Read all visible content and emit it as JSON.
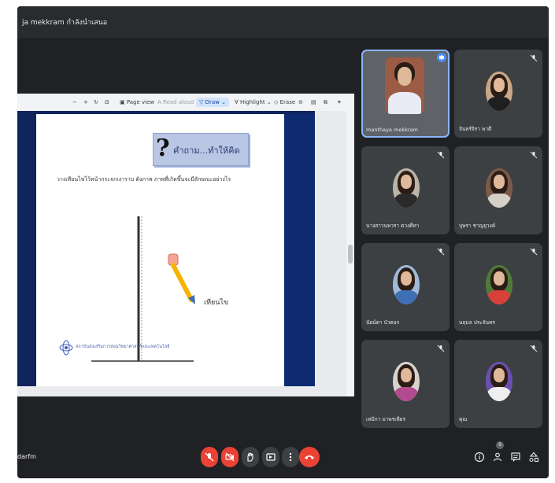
{
  "meeting": {
    "presenter_label": "ja mekkram กำลังนำเสนอ",
    "bottom_left_text": "darfm",
    "participant_count": "9"
  },
  "pdf_toolbar": {
    "zoom_out": "−",
    "zoom_in": "+",
    "page_view": "Page view",
    "read_aloud": "Read aloud",
    "draw": "Draw",
    "highlight": "Highlight",
    "erase": "Erase"
  },
  "slide": {
    "question_mark": "?",
    "question_text": "คำถาม...ทำให้คิด",
    "instruction": "วางเทียนไขไว้หน้ากระจกเงาราบ ดังภาพ ภาพที่เกิดขึ้นจะมีลักษณะอย่างไร",
    "pencil_label": "เทียนไข",
    "footer_text": "สถาบันส่งเสริมการสอนวิทยาศาสตร์และเทคโนโลยี"
  },
  "participants": [
    {
      "name": "manthaya mekkram",
      "speaking": true
    },
    {
      "name": "จันทร์จิรา พาดี",
      "speaking": false
    },
    {
      "name": "นางสาวนพวรา ดวงดีทา",
      "speaking": false
    },
    {
      "name": "บุษรา ชาญยุวงค์",
      "speaking": false
    },
    {
      "name": "นัยน์ตา บัวดอก",
      "speaking": false
    },
    {
      "name": "นฤมล ประจันทร",
      "speaking": false
    },
    {
      "name": "เหมิกา มาพรเพียร",
      "speaking": false
    },
    {
      "name": "คุณ",
      "speaking": false
    }
  ],
  "colors": {
    "background": "#202124",
    "tile": "#3c4043",
    "red_control": "#ea4335",
    "active_speaker": "#8ab4f8"
  }
}
